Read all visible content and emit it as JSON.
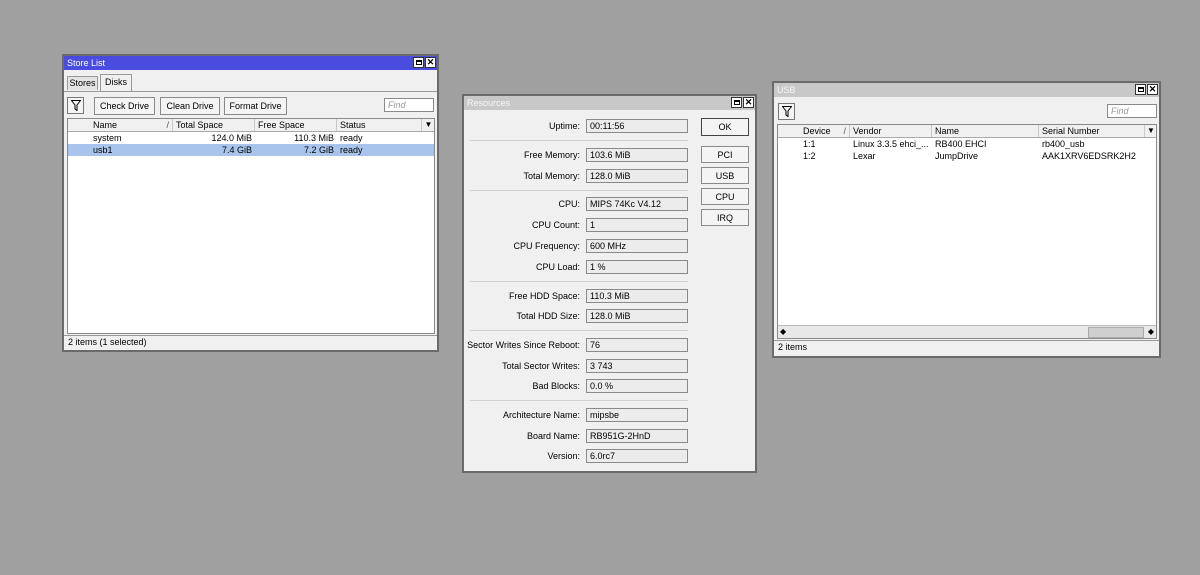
{
  "store_list": {
    "title": "Store List",
    "tabs": [
      "Stores",
      "Disks"
    ],
    "toolbar": {
      "check_drive": "Check Drive",
      "clean_drive": "Clean Drive",
      "format_drive": "Format Drive",
      "find_placeholder": "Find"
    },
    "columns": [
      "Name",
      "Total Space",
      "Free Space",
      "Status"
    ],
    "rows": [
      {
        "name": "system",
        "total": "124.0 MiB",
        "free": "110.3 MiB",
        "status": "ready",
        "selected": false
      },
      {
        "name": "usb1",
        "total": "7.4 GiB",
        "free": "7.2 GiB",
        "status": "ready",
        "selected": true
      }
    ],
    "status": "2 items (1 selected)"
  },
  "resources": {
    "title": "Resources",
    "fields": {
      "uptime": {
        "label": "Uptime:",
        "value": "00:11:56"
      },
      "free_memory": {
        "label": "Free Memory:",
        "value": "103.6 MiB"
      },
      "total_memory": {
        "label": "Total Memory:",
        "value": "128.0 MiB"
      },
      "cpu": {
        "label": "CPU:",
        "value": "MIPS 74Kc V4.12"
      },
      "cpu_count": {
        "label": "CPU Count:",
        "value": "1"
      },
      "cpu_frequency": {
        "label": "CPU Frequency:",
        "value": "600 MHz"
      },
      "cpu_load": {
        "label": "CPU Load:",
        "value": "1 %"
      },
      "free_hdd": {
        "label": "Free HDD Space:",
        "value": "110.3 MiB"
      },
      "total_hdd": {
        "label": "Total HDD Size:",
        "value": "128.0 MiB"
      },
      "sector_writes": {
        "label": "Sector Writes Since Reboot:",
        "value": "76"
      },
      "total_sector_writes": {
        "label": "Total Sector Writes:",
        "value": "3 743"
      },
      "bad_blocks": {
        "label": "Bad Blocks:",
        "value": "0.0 %"
      },
      "arch": {
        "label": "Architecture Name:",
        "value": "mipsbe"
      },
      "board": {
        "label": "Board Name:",
        "value": "RB951G-2HnD"
      },
      "version": {
        "label": "Version:",
        "value": "6.0rc7"
      }
    },
    "buttons": {
      "ok": "OK",
      "pci": "PCI",
      "usb": "USB",
      "cpu": "CPU",
      "irq": "IRQ"
    }
  },
  "usb": {
    "title": "USB",
    "find_placeholder": "Find",
    "columns": [
      "Device",
      "Vendor",
      "Name",
      "Serial Number"
    ],
    "rows": [
      {
        "device": "1:1",
        "vendor": "Linux 3.3.5 ehci_...",
        "name": "RB400 EHCI",
        "serial": "rb400_usb"
      },
      {
        "device": "1:2",
        "vendor": "Lexar",
        "name": "JumpDrive",
        "serial": "AAK1XRV6EDSRK2H2"
      }
    ],
    "status": "2 items"
  },
  "icons": {
    "filter": "filter-icon",
    "minimize": "minimize-icon",
    "close": "close-icon",
    "dropdown": "dropdown-arrow-icon",
    "sort": "sort-icon"
  },
  "colors": {
    "active_title": "#4a4ce0",
    "inactive_title": "#c8c8c8",
    "selection": "#a8c4ec",
    "desktop": "#a0a0a0"
  }
}
